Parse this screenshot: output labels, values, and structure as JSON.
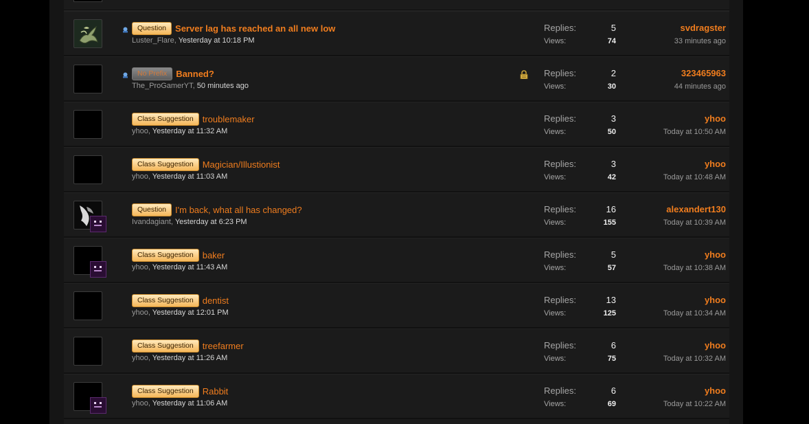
{
  "labels": {
    "replies": "Replies:",
    "views": "Views:"
  },
  "threads": [
    {
      "prefix": "Question",
      "prefix_style": "normal",
      "title": "Server lag has reached an all new low",
      "title_bold": true,
      "author": "Luster_Flare",
      "started": "Yesterday at 10:18 PM",
      "replies": "5",
      "views": "74",
      "last_user": "svdragster",
      "last_time": "33 minutes ago",
      "unread": true,
      "locked": false,
      "avatar": "dragon",
      "badge": false
    },
    {
      "prefix": "No Prefix",
      "prefix_style": "noprefix",
      "title": "Banned?",
      "title_bold": true,
      "author": "The_ProGamerYT",
      "started": "50 minutes ago",
      "replies": "2",
      "views": "30",
      "last_user": "323465963",
      "last_time": "44 minutes ago",
      "unread": true,
      "locked": true,
      "avatar": "blank",
      "badge": false
    },
    {
      "prefix": "Class Suggestion",
      "prefix_style": "normal",
      "title": "troublemaker",
      "title_bold": false,
      "author": "yhoo",
      "started": "Yesterday at 11:32 AM",
      "replies": "3",
      "views": "50",
      "last_user": "yhoo",
      "last_time": "Today at 10:50 AM",
      "unread": false,
      "locked": false,
      "avatar": "blank",
      "badge": false
    },
    {
      "prefix": "Class Suggestion",
      "prefix_style": "normal",
      "title": "Magician/Illustionist",
      "title_bold": false,
      "author": "yhoo",
      "started": "Yesterday at 11:03 AM",
      "replies": "3",
      "views": "42",
      "last_user": "yhoo",
      "last_time": "Today at 10:48 AM",
      "unread": false,
      "locked": false,
      "avatar": "blank",
      "badge": false
    },
    {
      "prefix": "Question",
      "prefix_style": "normal",
      "title": "I'm back, what all has changed?",
      "title_bold": false,
      "author": "Ivandagiant",
      "started": "Yesterday at 6:23 PM",
      "replies": "16",
      "views": "155",
      "last_user": "alexandert130",
      "last_time": "Today at 10:39 AM",
      "unread": false,
      "locked": false,
      "avatar": "wolf",
      "badge": true
    },
    {
      "prefix": "Class Suggestion",
      "prefix_style": "normal",
      "title": "baker",
      "title_bold": false,
      "author": "yhoo",
      "started": "Yesterday at 11:43 AM",
      "replies": "5",
      "views": "57",
      "last_user": "yhoo",
      "last_time": "Today at 10:38 AM",
      "unread": false,
      "locked": false,
      "avatar": "blank",
      "badge": true
    },
    {
      "prefix": "Class Suggestion",
      "prefix_style": "normal",
      "title": "dentist",
      "title_bold": false,
      "author": "yhoo",
      "started": "Yesterday at 12:01 PM",
      "replies": "13",
      "views": "125",
      "last_user": "yhoo",
      "last_time": "Today at 10:34 AM",
      "unread": false,
      "locked": false,
      "avatar": "blank",
      "badge": false
    },
    {
      "prefix": "Class Suggestion",
      "prefix_style": "normal",
      "title": "treefarmer",
      "title_bold": false,
      "author": "yhoo",
      "started": "Yesterday at 11:26 AM",
      "replies": "6",
      "views": "75",
      "last_user": "yhoo",
      "last_time": "Today at 10:32 AM",
      "unread": false,
      "locked": false,
      "avatar": "blank",
      "badge": false
    },
    {
      "prefix": "Class Suggestion",
      "prefix_style": "normal",
      "title": "Rabbit",
      "title_bold": false,
      "author": "yhoo",
      "started": "Yesterday at 11:06 AM",
      "replies": "6",
      "views": "69",
      "last_user": "yhoo",
      "last_time": "Today at 10:22 AM",
      "unread": false,
      "locked": false,
      "avatar": "blank",
      "badge": true
    }
  ]
}
